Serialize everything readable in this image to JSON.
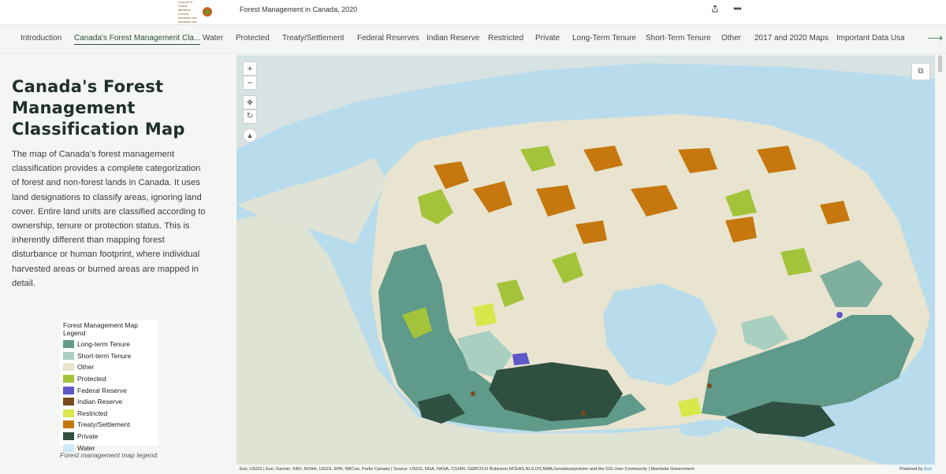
{
  "header": {
    "logo_text": "Canadian Council of Forest Ministers · Conseil canadien des ministres des forêts",
    "title": "Forest Management in Canada, 2020",
    "share_icon": "share-icon",
    "more_icon": "more-icon"
  },
  "nav": {
    "items": [
      {
        "label": "Introduction"
      },
      {
        "label": "Canada's Forest Management Cla..."
      },
      {
        "label": "Water"
      },
      {
        "label": "Protected"
      },
      {
        "label": "Treaty/Settlement"
      },
      {
        "label": "Federal Reserves"
      },
      {
        "label": "Indian Reserve"
      },
      {
        "label": "Restricted"
      },
      {
        "label": "Private"
      },
      {
        "label": "Long-Term Tenure"
      },
      {
        "label": "Short-Term Tenure"
      },
      {
        "label": "Other"
      },
      {
        "label": "2017 and 2020 Maps"
      },
      {
        "label": "Important Data Usage"
      }
    ],
    "active_index": 1,
    "next_icon": "arrow-right-icon"
  },
  "panel": {
    "title": "Canada's Forest Management Classification Map",
    "body": "The map of Canada's forest management classification provides a complete categorization of forest and non-forest lands in Canada. It uses land designations to classify areas, ignoring land cover. Entire land units are classified according to ownership, tenure or protection status. This is inherently different than mapping forest disturbance or human footprint, where individual harvested areas or burned areas are mapped in detail.",
    "legend": {
      "title": "Forest Management Map Legend",
      "items": [
        {
          "label": "Long-term Tenure",
          "color": "#5f9a8a"
        },
        {
          "label": "Short-term Tenure",
          "color": "#a9cfc0"
        },
        {
          "label": "Other",
          "color": "#e8e4cf"
        },
        {
          "label": "Protected",
          "color": "#a3c43a"
        },
        {
          "label": "Federal Reserve",
          "color": "#5f58c7"
        },
        {
          "label": "Indian Reserve",
          "color": "#7a4a1a"
        },
        {
          "label": "Restricted",
          "color": "#d8e84a"
        },
        {
          "label": "Treaty/Settlement",
          "color": "#c6780e"
        },
        {
          "label": "Private",
          "color": "#2f4f40"
        },
        {
          "label": "Water",
          "color": "#cfe8f5"
        }
      ]
    },
    "caption": "Forest management map legend."
  },
  "map": {
    "zoom_in": "+",
    "zoom_out": "−",
    "pan_icon": "pan-icon",
    "rotate_icon": "rotate-icon",
    "compass_icon": "compass-icon",
    "expand_icon": "open-external-icon",
    "attribution": "Esri, USGS | Esri, Garmin, FAO, NOAA, USGS, EPA, NRCan, Parks Canada | Source: USGS, NGA, NASA, CGIAR, GEBCO,N Robinson,NCEAS,NLS,OS,NMA,Geodatastyrelsen and the GIS User Community | Manitoba Government",
    "powered_by": "Powered by",
    "powered_brand": "Esri"
  }
}
